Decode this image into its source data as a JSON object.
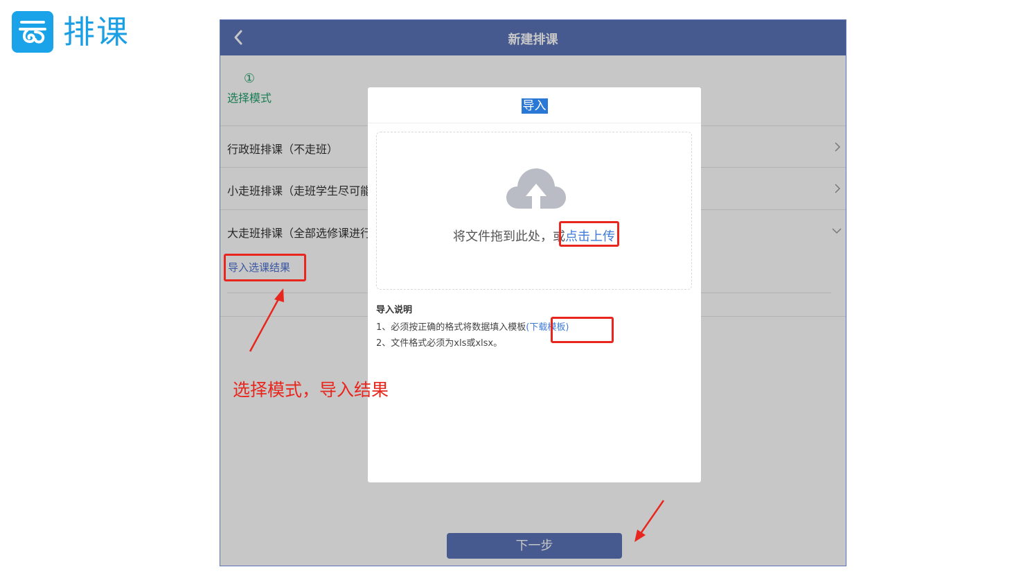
{
  "brand": {
    "title": "排课",
    "icon": "cloud-logo-icon",
    "color": "#1aa3e8"
  },
  "app": {
    "title": "新建排课",
    "back_icon": "chevron-left-icon",
    "accent": "#5a74b8",
    "step": {
      "number": "①",
      "label": "选择模式"
    },
    "modes": [
      {
        "label": "行政班排课（不走班）",
        "chevron": ">"
      },
      {
        "label": "小走班排课（走班学生尽可能",
        "chevron": ">"
      },
      {
        "label": "大走班排课（全部选修课进行",
        "chevron": "v"
      }
    ],
    "import_link": "导入选课结果",
    "next_button": "下一步"
  },
  "modal": {
    "title": "导入",
    "upload_icon": "cloud-upload-icon",
    "drop_text": "将文件拖到此处，或",
    "drop_link": "点击上传",
    "notes_title": "导入说明",
    "note1_prefix": "1、必须按正确的格式将数据填入模板",
    "note1_link": "(下载模板)",
    "note2": "2、文件格式必须为xls或xlsx。"
  },
  "annotation": {
    "text": "选择模式，导入结果",
    "color": "#e8261d"
  }
}
